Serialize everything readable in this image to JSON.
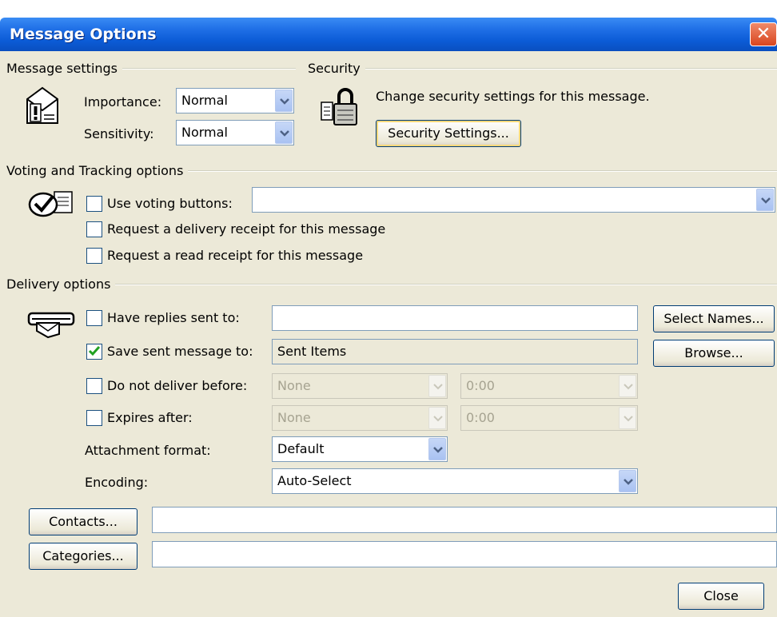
{
  "window": {
    "title": "Message Options",
    "close_glyph": "✕"
  },
  "message_settings": {
    "group_title": "Message settings",
    "icon": "envelope-important-icon",
    "importance_label": "Importance:",
    "importance_value": "Normal",
    "sensitivity_label": "Sensitivity:",
    "sensitivity_value": "Normal"
  },
  "security": {
    "group_title": "Security",
    "icon": "padlock-icon",
    "description": "Change security settings for this message.",
    "button_label": "Security Settings..."
  },
  "voting": {
    "group_title": "Voting and Tracking options",
    "icon": "checkmark-document-icon",
    "use_voting_label": "Use voting buttons:",
    "use_voting_checked": false,
    "voting_value": "",
    "delivery_receipt_label": "Request a delivery receipt for this message",
    "delivery_receipt_checked": false,
    "read_receipt_label": "Request a read receipt for this message",
    "read_receipt_checked": false
  },
  "delivery": {
    "group_title": "Delivery options",
    "icon": "envelope-hand-icon",
    "replies_label": "Have replies sent to:",
    "replies_checked": false,
    "replies_value": "",
    "select_names_label": "Select Names...",
    "save_sent_label": "Save sent message to:",
    "save_sent_checked": true,
    "save_sent_value": "Sent Items",
    "browse_label": "Browse...",
    "do_not_deliver_label": "Do not deliver before:",
    "do_not_deliver_checked": false,
    "do_not_deliver_date": "None",
    "do_not_deliver_time": "0:00",
    "expires_label": "Expires after:",
    "expires_checked": false,
    "expires_date": "None",
    "expires_time": "0:00",
    "attachment_label": "Attachment format:",
    "attachment_value": "Default",
    "encoding_label": "Encoding:",
    "encoding_value": "Auto-Select"
  },
  "footer": {
    "contacts_label": "Contacts...",
    "contacts_value": "",
    "categories_label": "Categories...",
    "categories_value": "",
    "close_label": "Close"
  },
  "colors": {
    "titlebar": "#0b5bd6",
    "dialog_bg": "#ece9d8",
    "close_red": "#d8451f"
  }
}
